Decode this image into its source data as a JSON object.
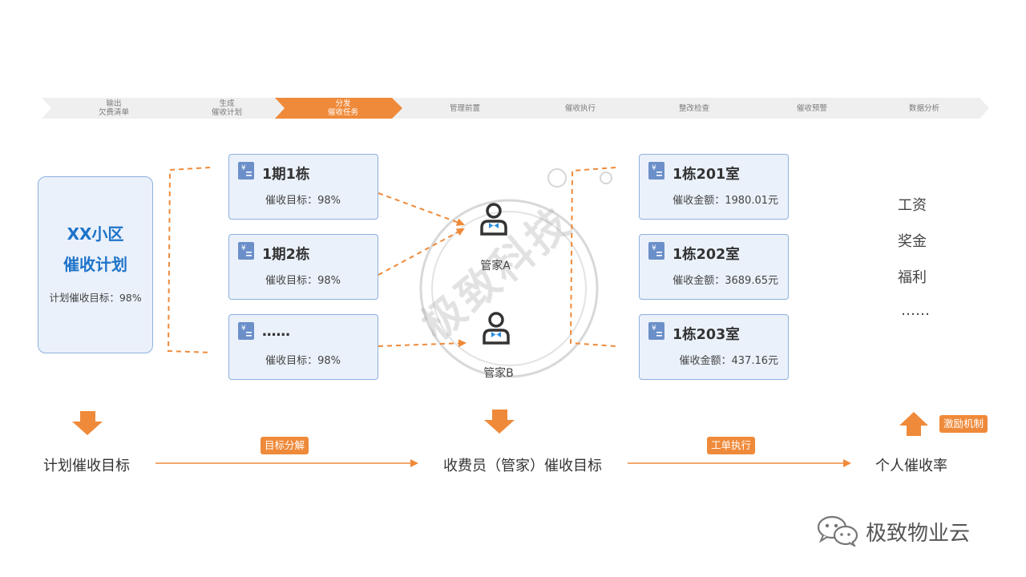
{
  "steps": [
    {
      "line1": "输出",
      "line2": "欠费清单",
      "active": false
    },
    {
      "line1": "生成",
      "line2": "催收计划",
      "active": false
    },
    {
      "line1": "分发",
      "line2": "催收任务",
      "active": true
    },
    {
      "line1": "管理前置",
      "line2": "",
      "active": false
    },
    {
      "line1": "催收执行",
      "line2": "",
      "active": false
    },
    {
      "line1": "整改检查",
      "line2": "",
      "active": false
    },
    {
      "line1": "催收预警",
      "line2": "",
      "active": false
    },
    {
      "line1": "数据分析",
      "line2": "",
      "active": false
    }
  ],
  "plan": {
    "title_line1": "XX小区",
    "title_line2": "催收计划",
    "target": "计划催收目标：98%"
  },
  "buildings": [
    {
      "title": "1期1栋",
      "target": "催收目标：98%"
    },
    {
      "title": "1期2栋",
      "target": "催收目标：98%"
    },
    {
      "title": "……",
      "target": "催收目标：98%"
    }
  ],
  "managers": [
    {
      "label": "管家A"
    },
    {
      "label": "管家B"
    }
  ],
  "rooms": [
    {
      "title": "1栋201室",
      "amount": "催收金额：1980.01元"
    },
    {
      "title": "1栋202室",
      "amount": "催收金额：3689.65元"
    },
    {
      "title": "1栋203室",
      "amount": "催收金额：437.16元"
    }
  ],
  "benefits": [
    "工资",
    "奖金",
    "福利",
    "……"
  ],
  "bottom": {
    "plan_goal": "计划催收目标",
    "decompose_tag": "目标分解",
    "collector_goal": "收费员（管家）催收目标",
    "workorder_tag": "工单执行",
    "personal_rate": "个人催收率",
    "incentive_tag": "激励机制"
  },
  "watermark": "极致科技",
  "brand": "极致物业云",
  "colors": {
    "accent": "#ef8a3a",
    "blue": "#1e73c9",
    "card_bg": "#eaf1fa",
    "card_border": "#8cb1de"
  }
}
